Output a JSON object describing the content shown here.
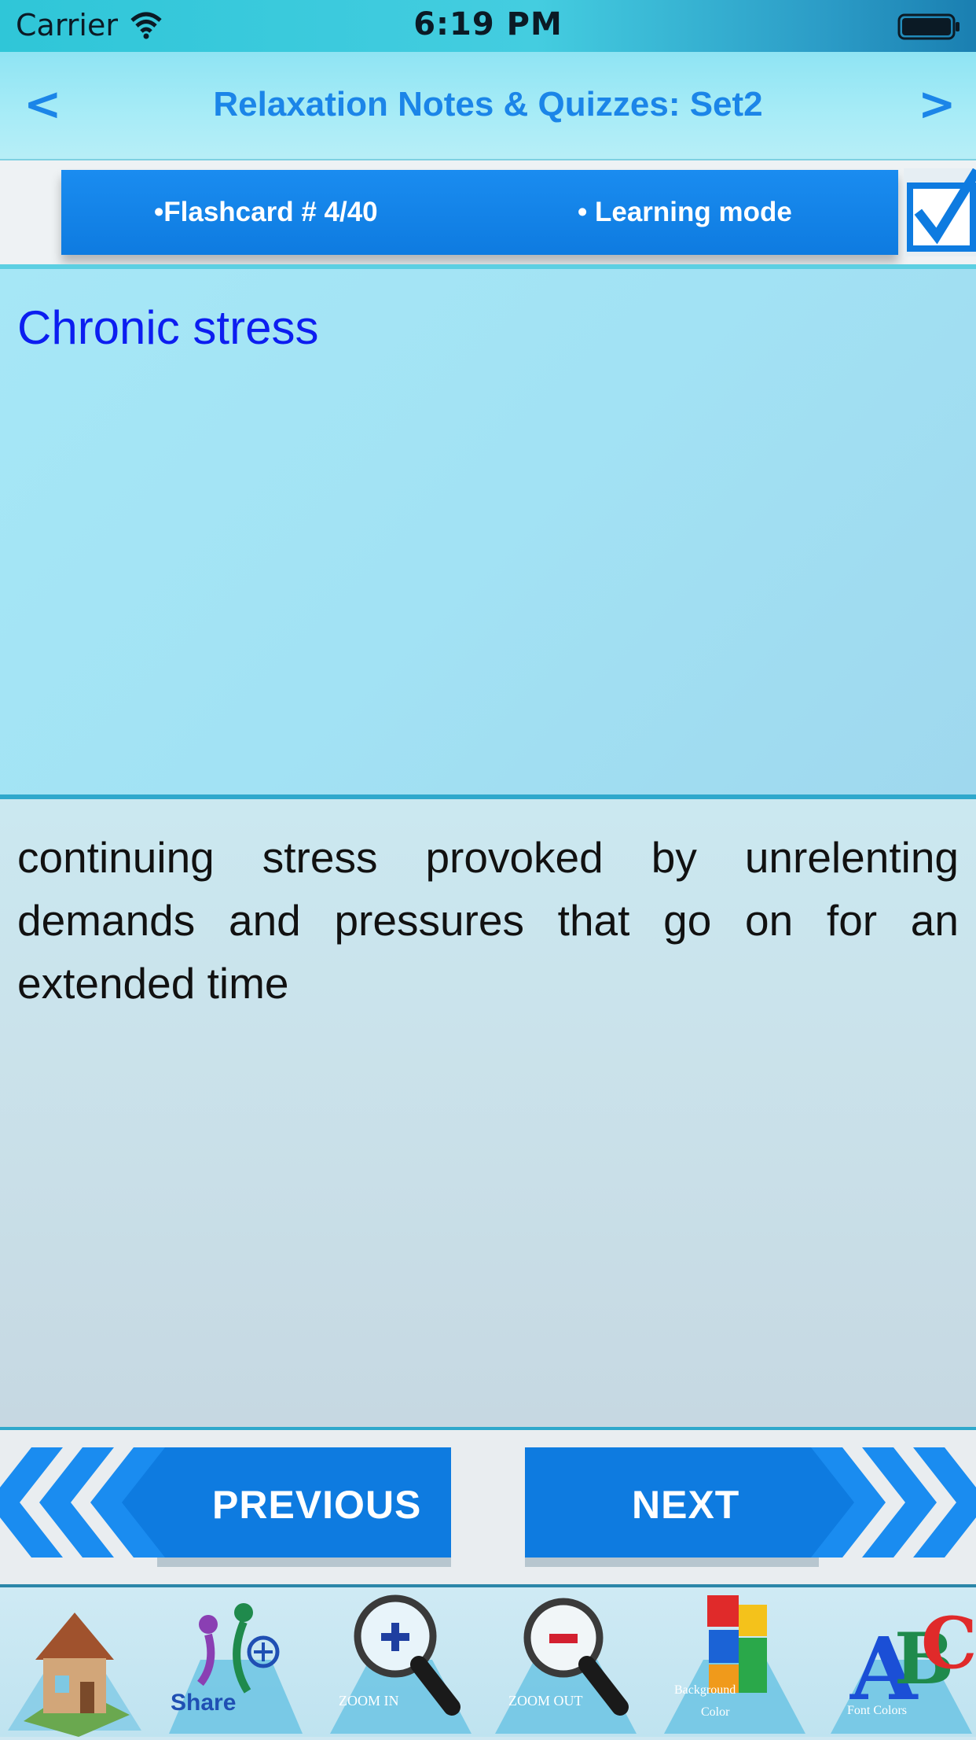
{
  "status_bar": {
    "carrier": "Carrier",
    "time": "6:19 PM"
  },
  "nav": {
    "back": "<",
    "title": "Relaxation Notes & Quizzes: Set2",
    "forward": ">"
  },
  "info": {
    "flashcard": "•Flashcard #  4/40",
    "mode": "• Learning mode"
  },
  "card": {
    "question": "Chronic stress",
    "answer": "continuing stress provoked by unrelenting demands and pressures that go on for an extended time"
  },
  "buttons": {
    "previous": "PREVIOUS",
    "next": "NEXT"
  },
  "toolbar": {
    "share": "Share",
    "zoom_in": "ZOOM IN",
    "zoom_out": "ZOOM OUT",
    "background": "Background",
    "color": "Color",
    "font_colors": "Font Colors"
  },
  "colors": {
    "accent": "#1b85e8",
    "question_text": "#0c1ef0",
    "button": "#0e7be0"
  }
}
